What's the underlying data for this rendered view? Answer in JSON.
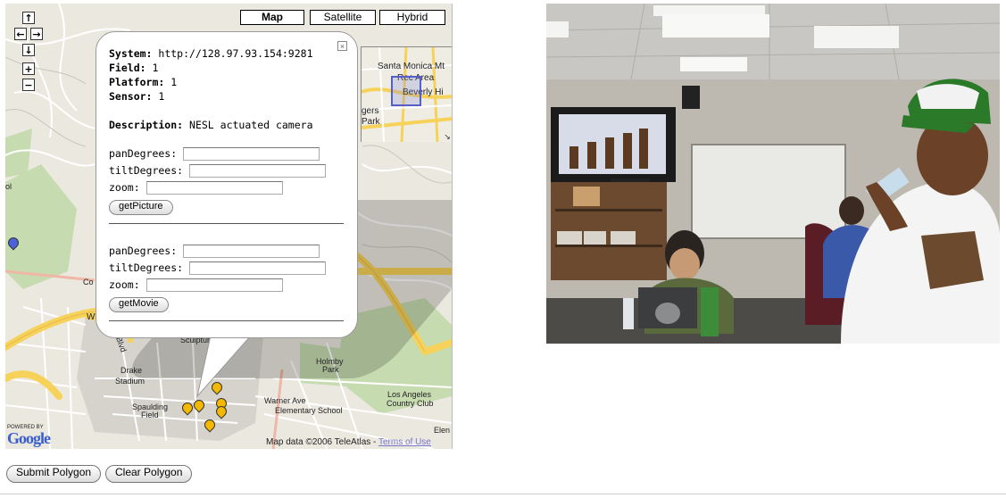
{
  "map": {
    "type_buttons": [
      "Map",
      "Satellite",
      "Hybrid"
    ],
    "active_type": "Map",
    "nav": {
      "up": "↑",
      "left": "←",
      "right": "→",
      "down": "↓",
      "zoom_in": "+",
      "zoom_out": "−"
    },
    "labels": {
      "sculpture": "Sculpture Ga",
      "drake": "Drake",
      "drake2": "Stadium",
      "spaulding": "Spaulding",
      "spaulding2": "Field",
      "holmby": "Holmby",
      "holmby2": "Park",
      "warner": "Warner Ave",
      "warner2": "Elementary School",
      "la_country": "Los Angeles",
      "la_country2": "Country Club",
      "blvd": "Blvd",
      "w": "W",
      "co": "Co",
      "ol": "ol",
      "elen": "Elen"
    },
    "powered_by": "POWERED BY",
    "google": "Google",
    "copyright": "Map data ©2006 TeleAtlas - ",
    "terms": "Terms of Use",
    "overview": {
      "santa_monica": "Santa Monica Mt",
      "rec_area": "Rec Area",
      "beverly": "Beverly Hi",
      "gers": "gers",
      "park": "Park",
      "toggle": "↘"
    },
    "marker_colors": {
      "yellow": "#f5b800",
      "blue": "#4a63d8"
    }
  },
  "info": {
    "close": "×",
    "system_label": "System:",
    "system_value": "http://128.97.93.154:9281",
    "field_label": "Field:",
    "field_value": "1",
    "platform_label": "Platform:",
    "platform_value": "1",
    "sensor_label": "Sensor:",
    "sensor_value": "1",
    "description_label": "Description:",
    "description_value": "NESL actuated camera",
    "pan_label": "panDegrees:",
    "tilt_label": "tiltDegrees:",
    "zoom_label": "zoom:",
    "get_picture": "getPicture",
    "get_movie": "getMovie"
  },
  "bottom": {
    "submit": "Submit Polygon",
    "clear": "Clear Polygon"
  }
}
